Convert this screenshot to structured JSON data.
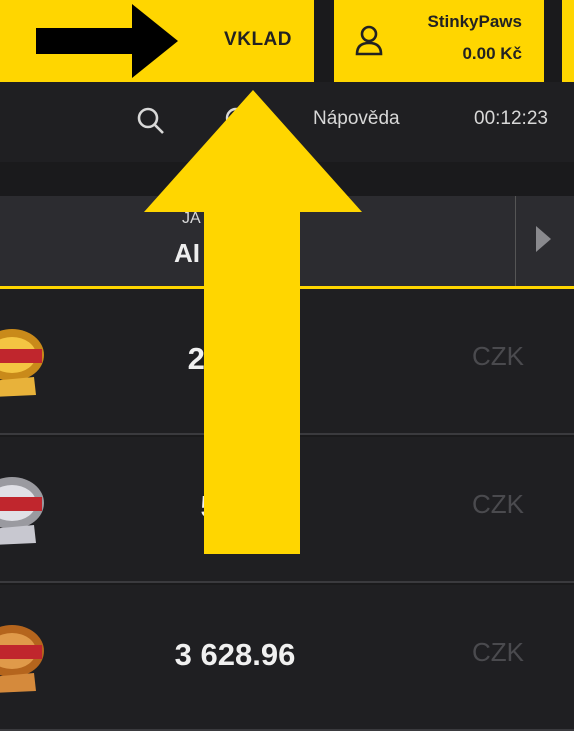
{
  "header_buttons": {
    "deposit_label": "VKLAD",
    "account_name": "StinkyPaws",
    "account_balance": "0.00 Kč"
  },
  "utility": {
    "help_label": "Nápověda",
    "clock": "00:12:23",
    "icons": [
      "search-icon",
      "ghost-icon"
    ]
  },
  "jackpot_header": {
    "sub_label": "JA",
    "main_label": "AI"
  },
  "jackpots": [
    {
      "amount": "263 97",
      "currency": "CZK"
    },
    {
      "amount": "5 2 7",
      "currency": "CZK"
    },
    {
      "amount": "3 628.96",
      "currency": "CZK"
    }
  ],
  "colors": {
    "accent": "#ffd600",
    "background": "#1f1f22",
    "annotation": "#000000"
  }
}
